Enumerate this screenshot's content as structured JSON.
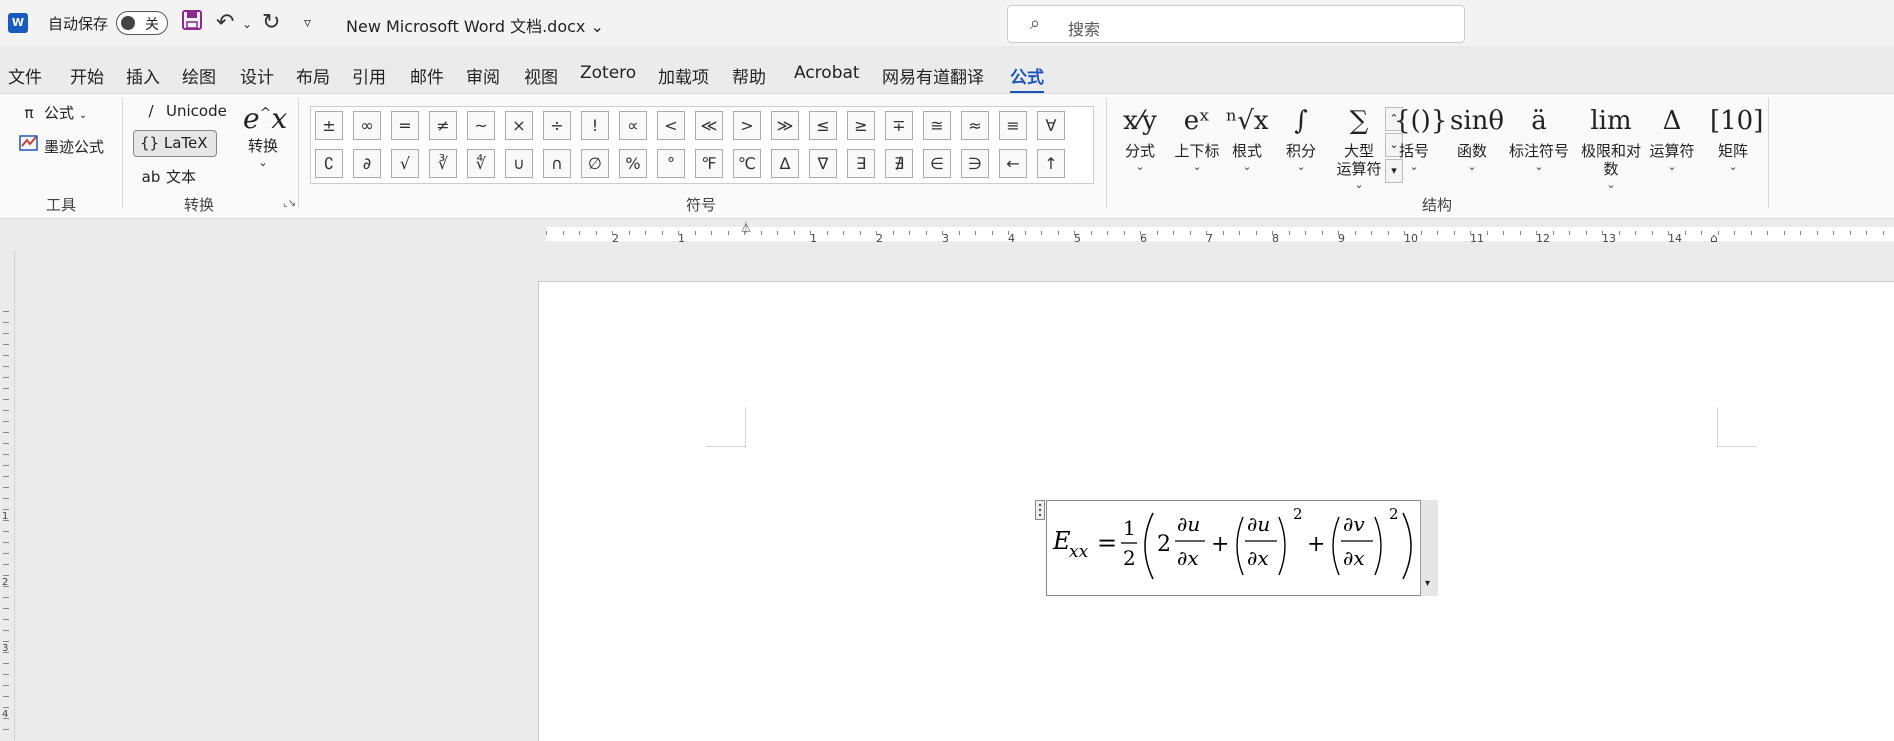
{
  "titlebar": {
    "app_icon": "word-icon",
    "autosave_label": "自动保存",
    "autosave_state": "关",
    "doc_title": "New Microsoft Word 文档.docx",
    "search_placeholder": "搜索"
  },
  "menu": {
    "tabs": [
      "文件",
      "开始",
      "插入",
      "绘图",
      "设计",
      "布局",
      "引用",
      "邮件",
      "审阅",
      "视图",
      "Zotero",
      "加载项",
      "帮助",
      "Acrobat",
      "网易有道翻译",
      "公式"
    ],
    "active": "公式"
  },
  "ribbon": {
    "tools": {
      "equation_label": "公式",
      "ink_label": "墨迹公式",
      "group_label": "工具"
    },
    "conversions": {
      "unicode_label": "Unicode",
      "latex_label": "LaTeX",
      "text_label": "文本",
      "convert_label": "转换",
      "group_label": "转换"
    },
    "symbols": {
      "group_label": "符号",
      "row1": [
        "±",
        "∞",
        "=",
        "≠",
        "~",
        "×",
        "÷",
        "!",
        "∝",
        "<",
        "≪",
        ">",
        "≫",
        "≤",
        "≥",
        "∓",
        "≅",
        "≈",
        "≡",
        "∀"
      ],
      "row2": [
        "∁",
        "∂",
        "√",
        "∛",
        "∜",
        "∪",
        "∩",
        "∅",
        "%",
        "°",
        "℉",
        "℃",
        "∆",
        "∇",
        "∃",
        "∄",
        "∈",
        "∋",
        "←",
        "↑"
      ]
    },
    "structures": {
      "group_label": "结构",
      "items": [
        {
          "label": "分式",
          "icon": "fraction-icon"
        },
        {
          "label": "上下标",
          "icon": "script-icon"
        },
        {
          "label": "根式",
          "icon": "radical-icon"
        },
        {
          "label": "积分",
          "icon": "integral-icon"
        },
        {
          "label": "大型\n运算符",
          "icon": "large-operator-icon"
        },
        {
          "label": "括号",
          "icon": "bracket-icon"
        },
        {
          "label": "函数",
          "icon": "function-icon"
        },
        {
          "label": "标注符号",
          "icon": "accent-icon"
        },
        {
          "label": "极限和对数",
          "icon": "limit-log-icon"
        },
        {
          "label": "运算符",
          "icon": "operator-icon"
        },
        {
          "label": "矩阵",
          "icon": "matrix-icon"
        }
      ]
    }
  },
  "ruler": {
    "left_numbers": [
      "2",
      "1"
    ],
    "right_numbers": [
      "1",
      "2",
      "3",
      "4",
      "5",
      "6",
      "7",
      "8",
      "9",
      "10",
      "11",
      "12",
      "13",
      "14"
    ],
    "vertical_numbers": [
      "1",
      "2",
      "3",
      "4"
    ]
  },
  "equation": {
    "lhs": "E",
    "lhs_sub": "xx",
    "eq": "=",
    "half_num": "1",
    "half_den": "2",
    "coef": "2",
    "du": "∂u",
    "dx": "∂x",
    "dv": "∂v",
    "plus": "+",
    "exp": "2"
  }
}
